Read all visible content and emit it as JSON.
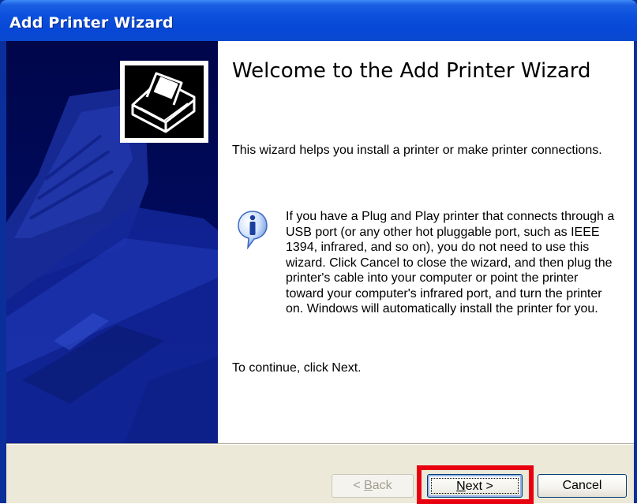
{
  "window": {
    "title": "Add Printer Wizard"
  },
  "side_panel": {
    "icon": "printer-wizard-icon",
    "background_color": "#000a5a"
  },
  "content": {
    "heading": "Welcome to the Add Printer Wizard",
    "intro": "This wizard helps you install a printer or make printer connections.",
    "info_icon": "info-icon",
    "info_text": "If you have a Plug and Play printer that connects through a USB port (or any other hot pluggable port, such as IEEE 1394, infrared, and so on), you do not need to use this wizard. Click Cancel to close the wizard, and then plug the printer's cable into your computer or point the printer toward your computer's infrared port, and turn the printer on. Windows will automatically install the printer for you.",
    "continue_text": "To continue, click Next."
  },
  "buttons": {
    "back": {
      "prefix": "< ",
      "mnemonic": "B",
      "rest": "ack",
      "enabled": false
    },
    "next": {
      "mnemonic": "N",
      "rest": "ext >",
      "enabled": true,
      "highlighted": true
    },
    "cancel": {
      "label": "Cancel",
      "enabled": true
    }
  },
  "colors": {
    "titlebar": "#0b50dc",
    "highlight_outline": "#e80010",
    "button_bar": "#ece9d8"
  }
}
